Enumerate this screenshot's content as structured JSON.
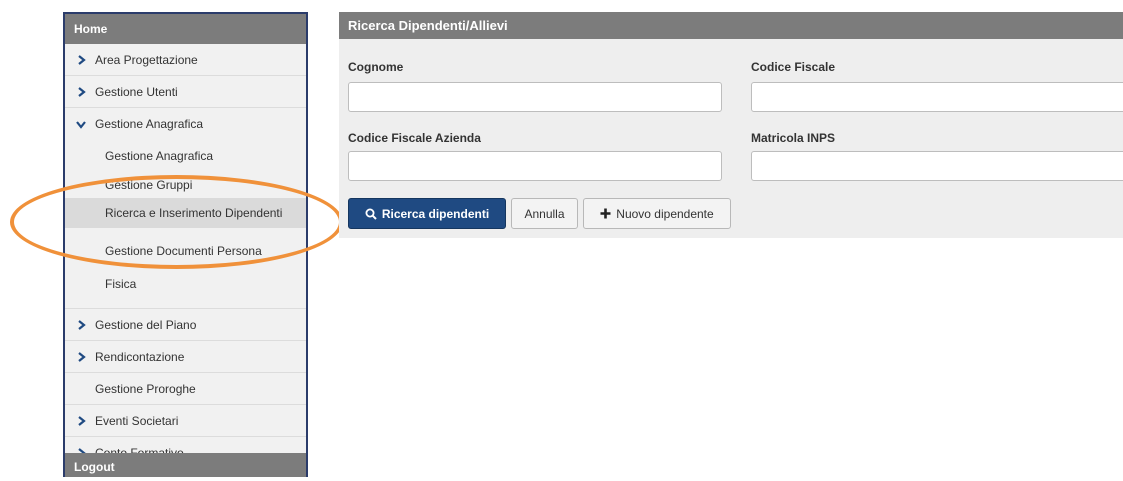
{
  "sidebar": {
    "header": "Home",
    "items": [
      {
        "label": "Area Progettazione",
        "chevron": "right"
      },
      {
        "label": "Gestione Utenti",
        "chevron": "right"
      },
      {
        "label": "Gestione Anagrafica",
        "chevron": "down"
      }
    ],
    "subitems": [
      {
        "label": "Gestione Anagrafica"
      },
      {
        "label": "Gestione Gruppi"
      },
      {
        "label": "Ricerca e Inserimento Dipendenti",
        "active": true
      },
      {
        "label": "Gestione Documenti Persona Fisica"
      }
    ],
    "items_after": [
      {
        "label": "Gestione del Piano",
        "chevron": "right"
      },
      {
        "label": "Rendicontazione",
        "chevron": "right"
      },
      {
        "label": "Gestione Proroghe",
        "chevron": "none"
      },
      {
        "label": "Eventi Societari",
        "chevron": "right"
      },
      {
        "label": "Conto Formativo",
        "chevron": "right"
      }
    ],
    "footer": "Logout"
  },
  "panel": {
    "title": "Ricerca Dipendenti/Allievi",
    "fields": {
      "cognome": {
        "label": "Cognome",
        "value": ""
      },
      "codice_fiscale": {
        "label": "Codice Fiscale",
        "value": ""
      },
      "codice_fiscale_azienda": {
        "label": "Codice Fiscale Azienda",
        "value": ""
      },
      "matricola_inps": {
        "label": "Matricola INPS",
        "value": ""
      }
    },
    "buttons": {
      "search": "Ricerca dipendenti",
      "cancel": "Annulla",
      "new": "Nuovo dipendente"
    }
  },
  "colors": {
    "header_gray": "#7c7c7c",
    "primary_blue": "#1f4a82",
    "highlight_orange": "#f0913a",
    "sidebar_border": "#2b3c6b"
  },
  "icons": {
    "chevron_right": "chevron-right-icon",
    "chevron_down": "chevron-down-icon",
    "search": "search-icon",
    "plus": "plus-icon"
  }
}
